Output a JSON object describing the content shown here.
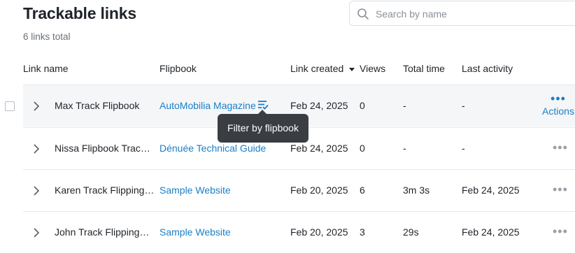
{
  "header": {
    "title": "Trackable links",
    "subtitle": "6 links total"
  },
  "search": {
    "placeholder": "Search by name"
  },
  "columns": {
    "link_name": "Link name",
    "flipbook": "Flipbook",
    "link_created": "Link created",
    "views": "Views",
    "total_time": "Total time",
    "last_activity": "Last activity"
  },
  "rows": [
    {
      "name": "Max Track Flipbook",
      "flipbook": "AutoMobilia Magazine",
      "created": "Feb 24, 2025",
      "views": "0",
      "total_time": "-",
      "last_activity": "-"
    },
    {
      "name": "Nissa Flipbook Trac…",
      "flipbook": "Dénuée Technical Guide",
      "created": "Feb 24, 2025",
      "views": "0",
      "total_time": "-",
      "last_activity": "-"
    },
    {
      "name": "Karen Track Flipping…",
      "flipbook": "Sample Website",
      "created": "Feb 20, 2025",
      "views": "6",
      "total_time": "3m 3s",
      "last_activity": "Feb 24, 2025"
    },
    {
      "name": "John Track Flipping…",
      "flipbook": "Sample Website",
      "created": "Feb 20, 2025",
      "views": "3",
      "total_time": "29s",
      "last_activity": "Feb 24, 2025"
    }
  ],
  "actions": {
    "label": "Actions",
    "dots": "•••"
  },
  "tooltip": {
    "text": "Filter by flipbook"
  },
  "icons": {
    "search": "search-icon",
    "chevron": "chevron-right-icon",
    "filter": "filter-list-icon",
    "more": "more-horizontal-icon"
  },
  "colors": {
    "link": "#1a7fc7",
    "tooltip_bg": "#3a3d42",
    "row_highlight": "#f5f6f8"
  }
}
